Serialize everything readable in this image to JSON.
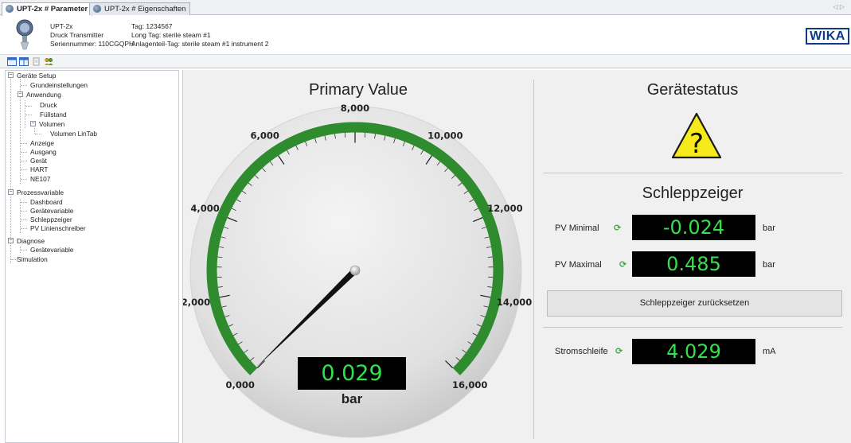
{
  "tabs": [
    {
      "label": "UPT-2x # Parameter",
      "active": true
    },
    {
      "label": "UPT-2x # Eigenschaften",
      "active": false
    }
  ],
  "tab_scroll_arrows": "◁ ▷",
  "device": {
    "model": "UPT-2x",
    "type": "Druck Transmitter",
    "serial": "Seriennummer: 110CGQPH",
    "tag": "Tag: 1234567",
    "long_tag": "Long Tag: sterile steam #1",
    "plant_tag": "Anlagenteil-Tag: sterile steam #1 instrument 2",
    "logo_text": "WIKA"
  },
  "tree": [
    {
      "label": "Geräte Setup",
      "level": 0,
      "expander": "−"
    },
    {
      "label": "Grundeinstellungen",
      "level": 1
    },
    {
      "label": "Anwendung",
      "level": 1,
      "expander": "−"
    },
    {
      "label": "Druck",
      "level": 2
    },
    {
      "label": "Füllstand",
      "level": 2
    },
    {
      "label": "Volumen",
      "level": 2,
      "expander": "−"
    },
    {
      "label": "Volumen LinTab",
      "level": 3
    },
    {
      "label": "Anzeige",
      "level": 1
    },
    {
      "label": "Ausgang",
      "level": 1
    },
    {
      "label": "Gerät",
      "level": 1
    },
    {
      "label": "HART",
      "level": 1
    },
    {
      "label": "NE107",
      "level": 1
    },
    {
      "label": "Prozessvariable",
      "level": 0,
      "expander": "−"
    },
    {
      "label": "Dashboard",
      "level": 1
    },
    {
      "label": "Gerätevariable",
      "level": 1
    },
    {
      "label": "Schleppzeiger",
      "level": 1
    },
    {
      "label": "PV Linienschreiber",
      "level": 1
    },
    {
      "label": "Diagnose",
      "level": 0,
      "expander": "−"
    },
    {
      "label": "Gerätevariable",
      "level": 1
    },
    {
      "label": "Simulation",
      "level": 0
    }
  ],
  "primary_value": {
    "title": "Primary Value",
    "value": "0.029",
    "unit": "bar",
    "numeric_value": 0.029,
    "scale_labels": [
      "0,000",
      "2,000",
      "4,000",
      "6,000",
      "8,000",
      "10,000",
      "12,000",
      "14,000",
      "16,000"
    ],
    "range": [
      0,
      16
    ]
  },
  "status": {
    "title": "Gerätestatus",
    "icon": "warning-question-icon"
  },
  "drag_pointer": {
    "title": "Schleppzeiger",
    "min_label": "PV Minimal",
    "min_value": "-0.024",
    "min_unit": "bar",
    "max_label": "PV Maximal",
    "max_value": "0.485",
    "max_unit": "bar",
    "reset_label": "Schleppzeiger zurücksetzen"
  },
  "loop_current": {
    "label": "Stromschleife",
    "value": "4.029",
    "unit": "mA"
  },
  "colors": {
    "gauge_arc": "#2e8b2e",
    "led_text": "#35e04a",
    "led_bg": "#000000",
    "refresh_icon": "#3ea63e"
  }
}
